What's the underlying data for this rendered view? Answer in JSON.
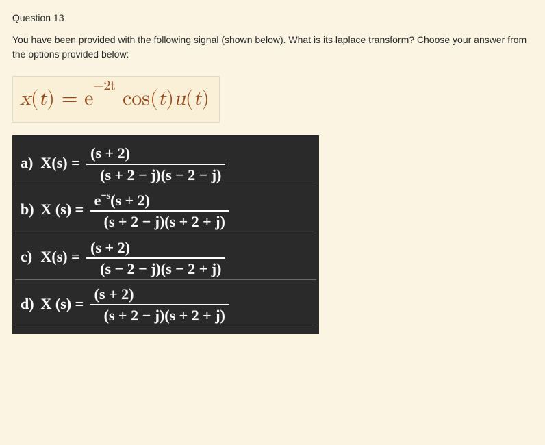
{
  "question": {
    "number_label": "Question 13",
    "prompt": "You have been provided with the following signal (shown  below). What is its laplace transform? Choose your answer from the options provided below:"
  },
  "equation": {
    "lhs_func": "x",
    "lhs_arg": "t",
    "rhs_base": "e",
    "rhs_exp": "−2t",
    "rhs_trig": "cos",
    "rhs_trig_arg": "t",
    "rhs_step": "u",
    "rhs_step_arg": "t"
  },
  "options": [
    {
      "key": "a)",
      "lhs": "X(s) =",
      "numerator": "(s + 2)",
      "denominator": "(s + 2 − j)(s − 2 − j)",
      "has_exp": false
    },
    {
      "key": "b)",
      "lhs": "X (s) =",
      "numerator_prefix": "e",
      "numerator_exp": "−s",
      "numerator_tail": "(s + 2)",
      "denominator": "(s + 2 − j)(s + 2 + j)",
      "has_exp": true
    },
    {
      "key": "c)",
      "lhs": "X(s) =",
      "numerator": "(s + 2)",
      "denominator": "(s − 2 − j)(s − 2 + j)",
      "has_exp": false
    },
    {
      "key": "d)",
      "lhs": "X (s) =",
      "numerator": "(s + 2)",
      "denominator": "(s + 2 − j)(s + 2 + j)",
      "has_exp": false
    }
  ]
}
